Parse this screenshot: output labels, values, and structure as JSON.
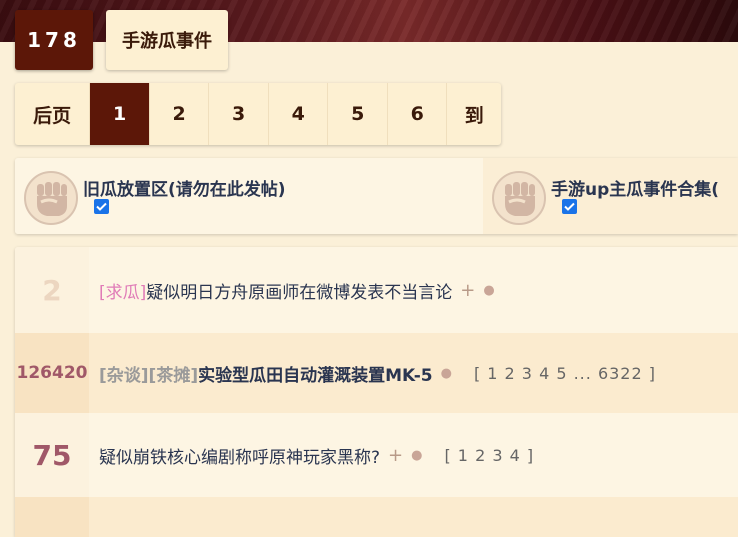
{
  "header": {
    "forum_id": "178",
    "forum_name": "手游瓜事件"
  },
  "pagination": {
    "prev_label": "后页",
    "pages": [
      "1",
      "2",
      "3",
      "4",
      "5",
      "6"
    ],
    "active_page": "1",
    "goto_label": "到"
  },
  "subforums": [
    {
      "name": "旧瓜放置区(请勿在此发帖)",
      "checked": true
    },
    {
      "name": "手游up主瓜事件合集(",
      "checked": true
    }
  ],
  "threads": [
    {
      "replies": "2",
      "tags": [
        {
          "text": "[求瓜]",
          "style": "pink"
        }
      ],
      "title": "疑似明日方舟原画师在微博发表不当言论",
      "bold": false,
      "has_plus": true,
      "pages": ""
    },
    {
      "replies": "126420",
      "tags": [
        {
          "text": "[杂谈]",
          "style": "gray"
        },
        {
          "text": "[茶摊]",
          "style": "gray"
        }
      ],
      "title": "实验型瓜田自动灌溉装置MK-5",
      "bold": true,
      "has_plus": false,
      "pages": "[ 1 2 3 4 5 ... 6322 ]"
    },
    {
      "replies": "75",
      "tags": [],
      "title": "疑似崩铁核心编剧称呼原神玩家黑称?",
      "bold": false,
      "has_plus": true,
      "pages": "[ 1 2 3 4 ]"
    }
  ],
  "colors": {
    "accent_dark": "#5c1708",
    "panel": "#fdf0d2",
    "link_title": "#2a3550",
    "reply_count": "#a05868",
    "tag_pink": "#e07bb7"
  },
  "icons": {
    "subforum_logo": "fist-logo-icon",
    "checkbox": "checkbox-checked-icon",
    "plus": "plus-icon",
    "dot": "dot-icon"
  }
}
